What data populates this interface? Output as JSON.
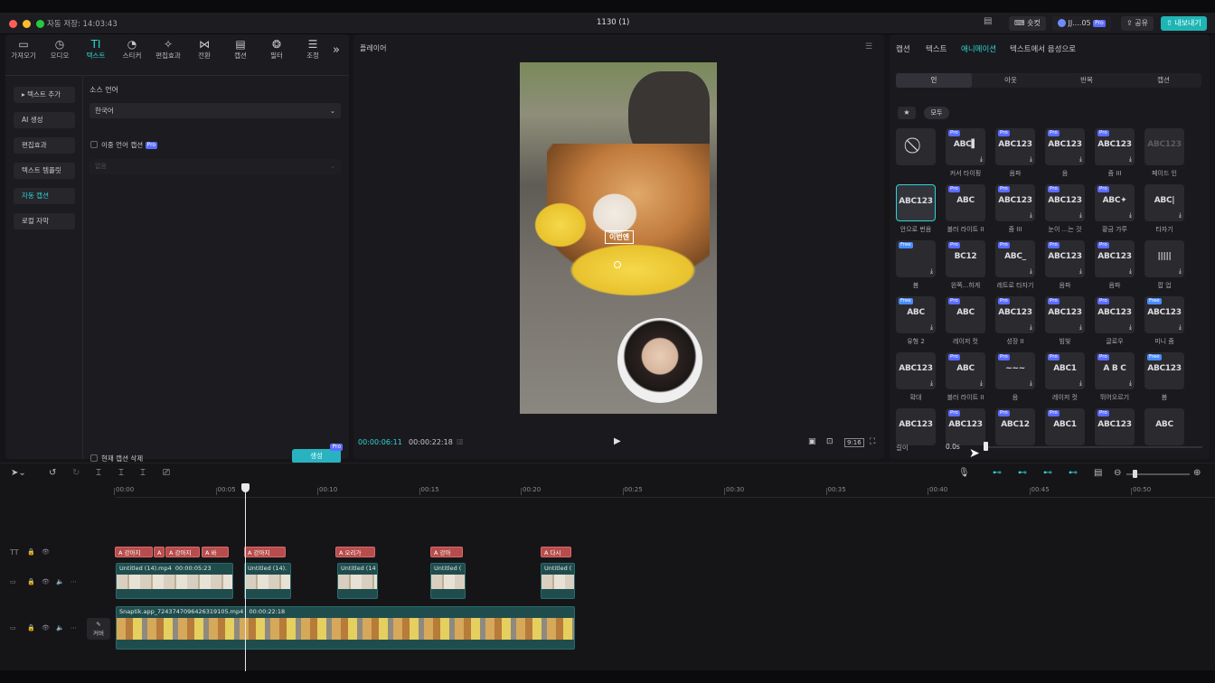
{
  "titlebar": {
    "autosave": "자동 저장: 14:03:43",
    "project": "1130 (1)",
    "shortcut": "숏컷",
    "user": "JJ....05",
    "pro": "Pro",
    "share": "공유",
    "export": "내보내기"
  },
  "tools": [
    {
      "label": "가져오기",
      "icon": "import-icon"
    },
    {
      "label": "오디오",
      "icon": "audio-icon"
    },
    {
      "label": "텍스트",
      "icon": "text-icon"
    },
    {
      "label": "스티커",
      "icon": "sticker-icon"
    },
    {
      "label": "편집효과",
      "icon": "effects-icon"
    },
    {
      "label": "전환",
      "icon": "transition-icon"
    },
    {
      "label": "캡션",
      "icon": "caption-icon"
    },
    {
      "label": "필터",
      "icon": "filter-icon"
    },
    {
      "label": "조정",
      "icon": "adjust-icon"
    }
  ],
  "left_nav": [
    "▸ 텍스트 추가",
    "AI 생성",
    "편집효과",
    "텍스트 템플릿",
    "자동 캡션",
    "로컬 자막"
  ],
  "captions": {
    "source_lang_label": "소스 언어",
    "source_lang_value": "한국어",
    "bilingual_label": "이중 언어 캡션",
    "bilingual_pro": "Pro",
    "second_lang_placeholder": "없음",
    "delete_current_label": "현재 캡션 삭제",
    "generate_label": "생성",
    "generate_pro": "Pro"
  },
  "player": {
    "title": "플레이어",
    "current_time": "00:00:06:11",
    "total_time": "00:00:22:18",
    "ratio": "9:16",
    "caption_text": "이번엔"
  },
  "right_tabs": [
    "캡션",
    "텍스트",
    "애니메이션",
    "텍스트에서 음성으로"
  ],
  "anim_segments": [
    "인",
    "아웃",
    "반복",
    "캡션"
  ],
  "anim_filter": {
    "all": "모두"
  },
  "tiles": [
    {
      "text": "",
      "badge": "",
      "label": "",
      "dl": false
    },
    {
      "text": "ABC▌",
      "badge": "Pro",
      "label": "커서 타이핑",
      "dl": true
    },
    {
      "text": "ABC123",
      "badge": "Pro",
      "label": "음파",
      "dl": true
    },
    {
      "text": "ABC123",
      "badge": "Pro",
      "label": "음",
      "dl": true
    },
    {
      "text": "ABC123",
      "badge": "Pro",
      "label": "줌 III",
      "dl": true
    },
    {
      "text": "ABC123",
      "badge": "",
      "label": "페이드 인",
      "dl": false
    },
    {
      "text": "ABC123",
      "badge": "",
      "label": "안으로 번음",
      "dl": false
    },
    {
      "text": "ABC",
      "badge": "Pro",
      "label": "블러 라이트 II",
      "dl": false
    },
    {
      "text": "ABC123",
      "badge": "Pro",
      "label": "줌 III",
      "dl": true
    },
    {
      "text": "ABC123",
      "badge": "Pro",
      "label": "눈이 ...는 것",
      "dl": true
    },
    {
      "text": "ABC✦",
      "badge": "Pro",
      "label": "황금 가루",
      "dl": true
    },
    {
      "text": "ABC|",
      "badge": "",
      "label": "타자기",
      "dl": true
    },
    {
      "text": "",
      "badge": "Free",
      "label": "봄",
      "dl": true
    },
    {
      "text": "BC12",
      "badge": "Pro",
      "label": "왼쪽...하게",
      "dl": false
    },
    {
      "text": "ABC_",
      "badge": "Pro",
      "label": "레트로 타자기",
      "dl": true
    },
    {
      "text": "ABC123",
      "badge": "Pro",
      "label": "음파",
      "dl": true
    },
    {
      "text": "ABC123",
      "badge": "Pro",
      "label": "음파",
      "dl": true
    },
    {
      "text": "|||||",
      "badge": "",
      "label": "팝 업",
      "dl": true
    },
    {
      "text": "ABC",
      "badge": "Free",
      "label": "유형 2",
      "dl": true
    },
    {
      "text": "ABC",
      "badge": "Pro",
      "label": "레이저 컷",
      "dl": false
    },
    {
      "text": "ABC123",
      "badge": "Pro",
      "label": "성장 II",
      "dl": true
    },
    {
      "text": "ABC123",
      "badge": "Pro",
      "label": "빔빛",
      "dl": true
    },
    {
      "text": "ABC123",
      "badge": "Pro",
      "label": "글로우",
      "dl": true
    },
    {
      "text": "ABC123",
      "badge": "Free",
      "label": "미니 줌",
      "dl": true
    },
    {
      "text": "ABC123",
      "badge": "",
      "label": "확대",
      "dl": true
    },
    {
      "text": "ABC",
      "badge": "Pro",
      "label": "블러 라이트 II",
      "dl": true
    },
    {
      "text": "~~~",
      "badge": "Pro",
      "label": "음",
      "dl": true
    },
    {
      "text": "ABC1",
      "badge": "Pro",
      "label": "레이저 컷",
      "dl": true
    },
    {
      "text": "A B C",
      "badge": "Pro",
      "label": "뛰어오르기",
      "dl": true
    },
    {
      "text": "ABC123",
      "badge": "Free",
      "label": "봄",
      "dl": false
    },
    {
      "text": "ABC123",
      "badge": "",
      "label": "",
      "dl": false
    },
    {
      "text": "ABC123",
      "badge": "Pro",
      "label": "",
      "dl": false
    },
    {
      "text": "ABC12",
      "badge": "Pro",
      "label": "",
      "dl": false
    },
    {
      "text": "ABC1",
      "badge": "Pro",
      "label": "",
      "dl": false
    },
    {
      "text": "ABC123",
      "badge": "Pro",
      "label": "",
      "dl": false
    },
    {
      "text": "ABC",
      "badge": "",
      "label": "",
      "dl": false
    }
  ],
  "length": {
    "label": "길이",
    "value": "0.0s"
  },
  "ruler": [
    "00:00",
    "00:05",
    "00:10",
    "00:15",
    "00:20",
    "00:25",
    "00:30",
    "00:35",
    "00:40",
    "00:45",
    "00:50"
  ],
  "text_clips": [
    "A 강아지",
    "A",
    "A 강아지",
    "A 바",
    "A 강아지",
    "A 오리가",
    "A 강아",
    "A 다시"
  ],
  "video_clips": [
    {
      "name": "Untitled (14).mp4",
      "dur": "00:00:05:23"
    },
    {
      "name": "Untitled (14).",
      "dur": ""
    },
    {
      "name": "Untitled (14",
      "dur": ""
    },
    {
      "name": "Untitled (",
      "dur": ""
    },
    {
      "name": "Untitled (",
      "dur": ""
    }
  ],
  "main_clip": {
    "name": "Snaptik.app_7243747096426319105.mp4",
    "dur": "00:00:22:18"
  },
  "cover_label": "커버"
}
